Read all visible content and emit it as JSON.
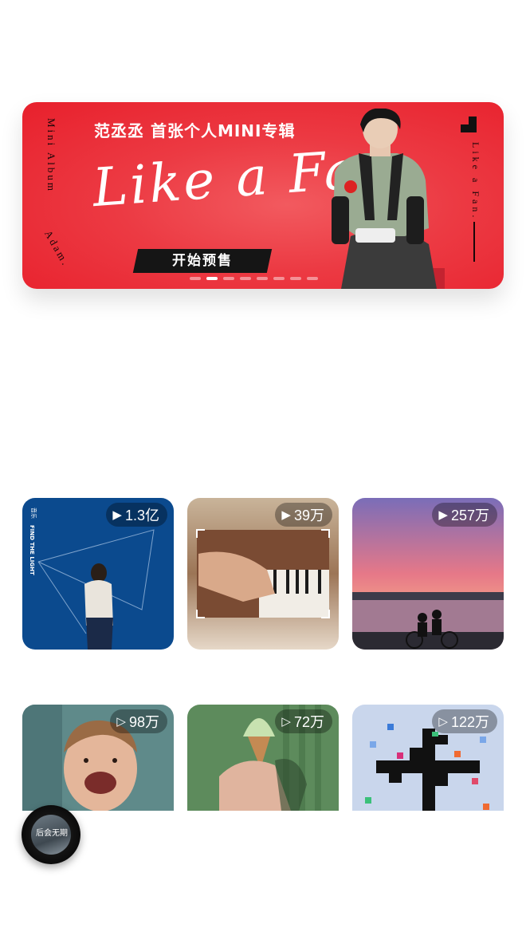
{
  "banner": {
    "headline": "范丞丞  首张个人MINI专辑",
    "script_title": "Like a Fan",
    "vertical_left": "Mini Album",
    "signature": "Adam.",
    "vertical_right": "Like a Fan.",
    "cta": "开始预售",
    "carousel_total": 8,
    "carousel_active": 2
  },
  "playlists": [
    {
      "play_count": "1.3亿",
      "cover_text": "FIND THE LIGHT",
      "cover_side": "音乐"
    },
    {
      "play_count": "39万"
    },
    {
      "play_count": "257万"
    },
    {
      "play_count": "98万"
    },
    {
      "play_count": "72万"
    },
    {
      "play_count": "122万"
    }
  ],
  "player": {
    "disc_text": "后会无期"
  }
}
